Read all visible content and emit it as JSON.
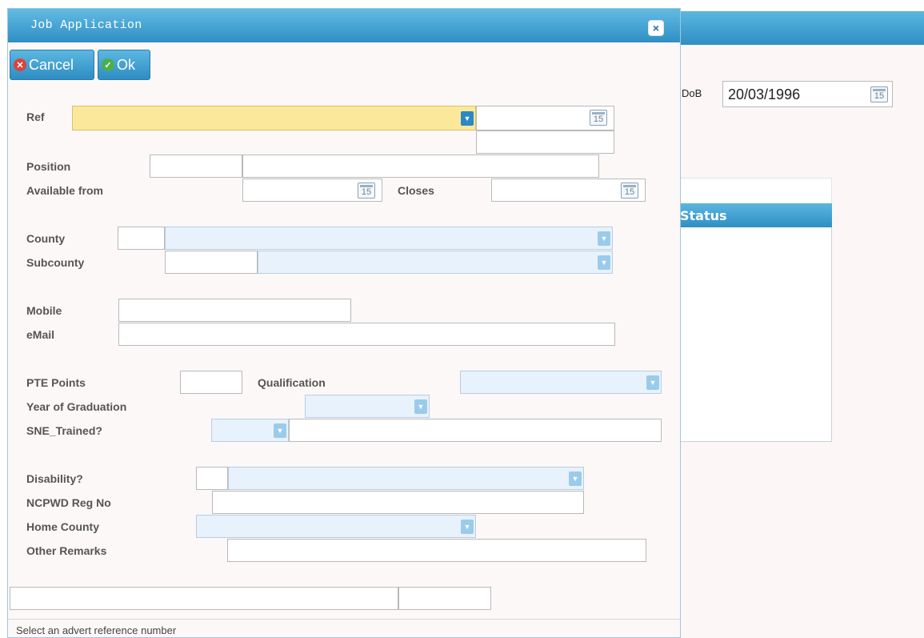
{
  "background": {
    "dob_label": "DoB",
    "dob_value": "20/03/1996",
    "calendar_day": "15",
    "status_header": "Status"
  },
  "dialog": {
    "title": "Job Application",
    "close_glyph": "×",
    "cancel_label": "Cancel",
    "ok_label": "Ok",
    "calendar_day": "15",
    "labels": {
      "ref": "Ref",
      "position": "Position",
      "available_from": "Available from",
      "closes": "Closes",
      "county": "County",
      "subcounty": "Subcounty",
      "mobile": "Mobile",
      "email": "eMail",
      "pte_points": "PTE Points",
      "qualification": "Qualification",
      "year_of_graduation": "Year of Graduation",
      "sne_trained": "SNE_Trained?",
      "disability": "Disability?",
      "ncpwd_reg_no": "NCPWD Reg No",
      "home_county": "Home County",
      "other_remarks": "Other Remarks"
    },
    "status_text": "Select an advert reference number"
  },
  "icons": {
    "cancel": "cancel-circle-icon",
    "ok": "check-circle-icon",
    "calendar": "calendar-icon",
    "dropdown": "chevron-down-icon"
  },
  "colors": {
    "titlebar": "#2f8fc4",
    "ref_highlight": "#fbe89a",
    "select_bg": "#e8f2fc"
  }
}
